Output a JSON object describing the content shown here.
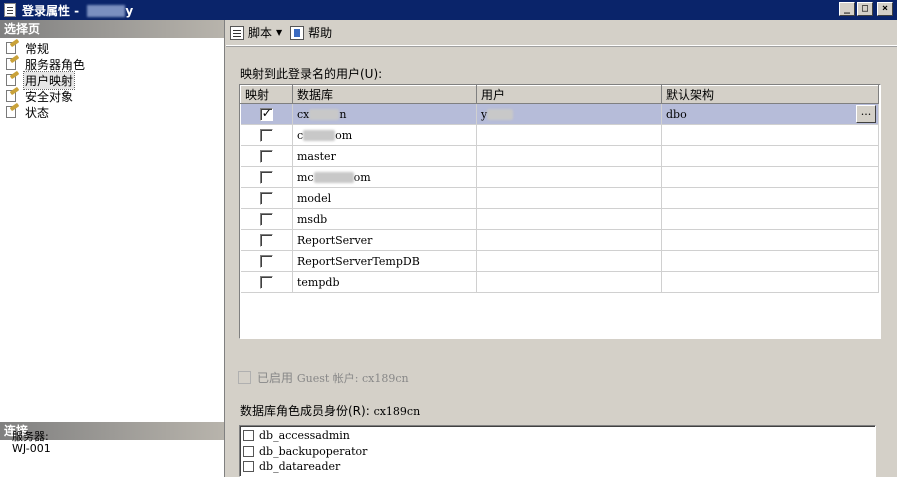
{
  "window": {
    "title": "登录属性 - ",
    "title_suffix": "y",
    "buttons": [
      "_",
      "□",
      "×"
    ]
  },
  "left_pane": {
    "header": "选择页",
    "pages": [
      {
        "label": "常规",
        "selected": false
      },
      {
        "label": "服务器角色",
        "selected": false
      },
      {
        "label": "用户映射",
        "selected": true
      },
      {
        "label": "安全对象",
        "selected": false
      },
      {
        "label": "状态",
        "selected": false
      }
    ],
    "connection_header": "连接",
    "server_label": "服务器:",
    "server_value": "WJ-001"
  },
  "toolbar": {
    "script_label": "脚本",
    "help_label": "帮助"
  },
  "mapping": {
    "label": "映射到此登录名的用户(U):",
    "columns": [
      "映射",
      "数据库",
      "用户",
      "默认架构"
    ],
    "rows": [
      {
        "mapped": true,
        "database_prefix": "cx",
        "database_suffix": "n",
        "user": "y",
        "schema": "dbo"
      },
      {
        "mapped": false,
        "database_prefix": "c",
        "database_suffix": "om",
        "user": "",
        "schema": ""
      },
      {
        "mapped": false,
        "database_prefix": "master",
        "database_suffix": "",
        "user": "",
        "schema": ""
      },
      {
        "mapped": false,
        "database_prefix": "mc",
        "database_suffix": "om",
        "user": "",
        "schema": ""
      },
      {
        "mapped": false,
        "database_prefix": "model",
        "database_suffix": "",
        "user": "",
        "schema": ""
      },
      {
        "mapped": false,
        "database_prefix": "msdb",
        "database_suffix": "",
        "user": "",
        "schema": ""
      },
      {
        "mapped": false,
        "database_prefix": "ReportServer",
        "database_suffix": "",
        "user": "",
        "schema": ""
      },
      {
        "mapped": false,
        "database_prefix": "ReportServerTempDB",
        "database_suffix": "",
        "user": "",
        "schema": ""
      },
      {
        "mapped": false,
        "database_prefix": "tempdb",
        "database_suffix": "",
        "user": "",
        "schema": ""
      }
    ],
    "ellipsis": "..."
  },
  "guest": {
    "label_cn": "已启用",
    "label_rest": "Guest 帐户: cx189cn"
  },
  "roles": {
    "label": "数据库角色成员身份(R): ",
    "db": "cx189cn",
    "items": [
      "db_accessadmin",
      "db_backupoperator",
      "db_datareader"
    ]
  }
}
